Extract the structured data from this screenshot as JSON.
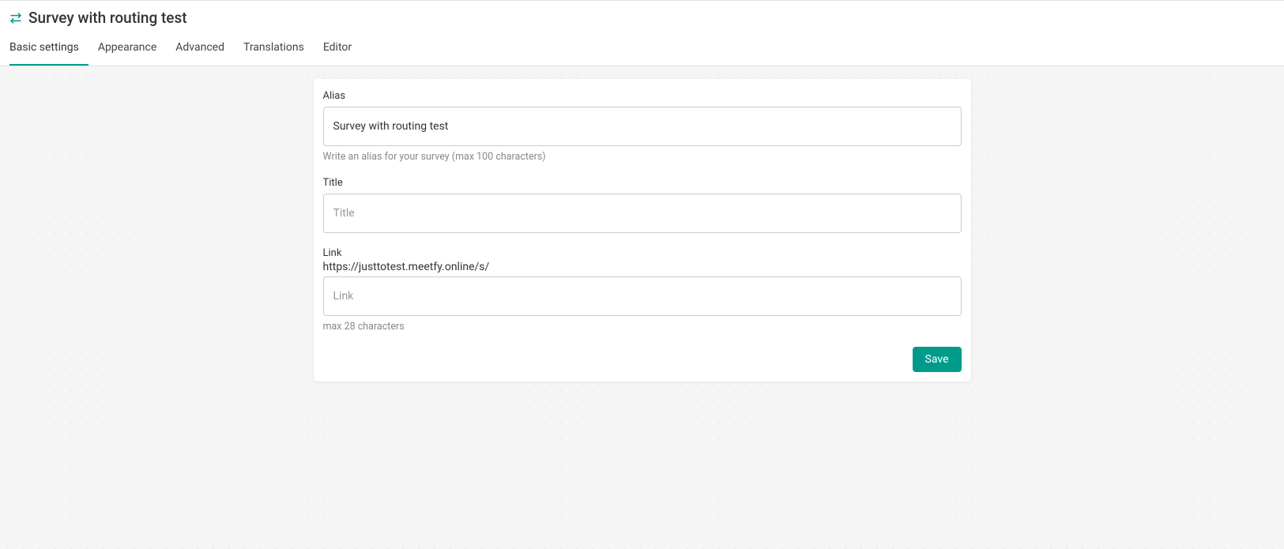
{
  "header": {
    "title": "Survey with routing test"
  },
  "tabs": [
    {
      "label": "Basic settings",
      "active": true
    },
    {
      "label": "Appearance",
      "active": false
    },
    {
      "label": "Advanced",
      "active": false
    },
    {
      "label": "Translations",
      "active": false
    },
    {
      "label": "Editor",
      "active": false
    }
  ],
  "form": {
    "alias": {
      "label": "Alias",
      "value": "Survey with routing test",
      "help": "Write an alias for your survey (max 100 characters)"
    },
    "title": {
      "label": "Title",
      "placeholder": "Title",
      "value": ""
    },
    "link": {
      "label": "Link",
      "url_prefix": "https://justtotest.meetfy.online/s/",
      "placeholder": "Link",
      "value": "",
      "help": "max 28 characters"
    },
    "save_label": "Save"
  }
}
